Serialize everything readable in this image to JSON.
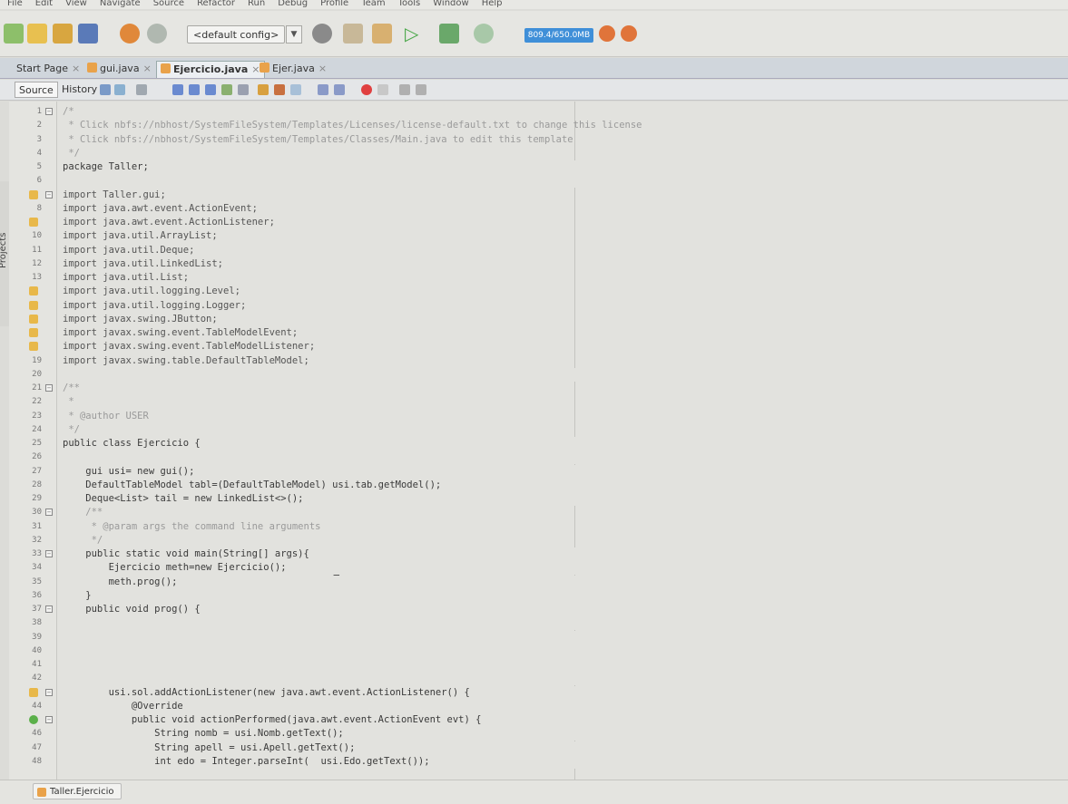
{
  "menu": [
    "File",
    "Edit",
    "View",
    "Navigate",
    "Source",
    "Refactor",
    "Run",
    "Debug",
    "Profile",
    "Team",
    "Tools",
    "Window",
    "Help"
  ],
  "toolbar": {
    "config_value": "<default config>",
    "memory": "809.4/650.0MB"
  },
  "tabs": [
    {
      "label": "Start Page",
      "active": false
    },
    {
      "label": "gui.java",
      "active": false
    },
    {
      "label": "Ejercicio.java",
      "active": true
    },
    {
      "label": "Ejer.java",
      "active": false
    }
  ],
  "editor_toolbar": {
    "source": "Source",
    "history": "History"
  },
  "side_panel": {
    "label": "Projects"
  },
  "code_lines": [
    {
      "n": "1",
      "text": "/*",
      "type": "comment",
      "fold": true
    },
    {
      "n": "2",
      "text": " * Click nbfs://nbhost/SystemFileSystem/Templates/Licenses/license-default.txt to change this license",
      "type": "comment"
    },
    {
      "n": "3",
      "text": " * Click nbfs://nbhost/SystemFileSystem/Templates/Classes/Main.java to edit this template",
      "type": "comment"
    },
    {
      "n": "4",
      "text": " */",
      "type": "comment"
    },
    {
      "n": "5",
      "text": "package Taller;",
      "type": "code"
    },
    {
      "n": "6",
      "text": "",
      "type": "code"
    },
    {
      "n": "",
      "text": "import Taller.gui;",
      "type": "import",
      "hint": "warn",
      "fold": true
    },
    {
      "n": "8",
      "text": "import java.awt.event.ActionEvent;",
      "type": "import"
    },
    {
      "n": "",
      "text": "import java.awt.event.ActionListener;",
      "type": "import",
      "hint": "warn"
    },
    {
      "n": "10",
      "text": "import java.util.ArrayList;",
      "type": "import"
    },
    {
      "n": "11",
      "text": "import java.util.Deque;",
      "type": "import"
    },
    {
      "n": "12",
      "text": "import java.util.LinkedList;",
      "type": "import"
    },
    {
      "n": "13",
      "text": "import java.util.List;",
      "type": "import"
    },
    {
      "n": "",
      "text": "import java.util.logging.Level;",
      "type": "import",
      "hint": "warn"
    },
    {
      "n": "",
      "text": "import java.util.logging.Logger;",
      "type": "import",
      "hint": "warn"
    },
    {
      "n": "",
      "text": "import javax.swing.JButton;",
      "type": "import",
      "hint": "warn"
    },
    {
      "n": "",
      "text": "import javax.swing.event.TableModelEvent;",
      "type": "import",
      "hint": "warn"
    },
    {
      "n": "",
      "text": "import javax.swing.event.TableModelListener;",
      "type": "import",
      "hint": "warn"
    },
    {
      "n": "19",
      "text": "import javax.swing.table.DefaultTableModel;",
      "type": "import"
    },
    {
      "n": "20",
      "text": "",
      "type": "code"
    },
    {
      "n": "21",
      "text": "/**",
      "type": "comment",
      "fold": true
    },
    {
      "n": "22",
      "text": " *",
      "type": "comment"
    },
    {
      "n": "23",
      "text": " * @author USER",
      "type": "comment"
    },
    {
      "n": "24",
      "text": " */",
      "type": "comment"
    },
    {
      "n": "25",
      "text": "public class Ejercicio {",
      "type": "code"
    },
    {
      "n": "26",
      "text": "",
      "type": "code"
    },
    {
      "n": "27",
      "text": "    gui usi= new gui();",
      "type": "code"
    },
    {
      "n": "28",
      "text": "    DefaultTableModel tabl=(DefaultTableModel) usi.tab.getModel();",
      "type": "code"
    },
    {
      "n": "29",
      "text": "    Deque<List> tail = new LinkedList<>();",
      "type": "code"
    },
    {
      "n": "30",
      "text": "    /**",
      "type": "comment",
      "fold": true
    },
    {
      "n": "31",
      "text": "     * @param args the command line arguments",
      "type": "comment"
    },
    {
      "n": "32",
      "text": "     */",
      "type": "comment"
    },
    {
      "n": "33",
      "text": "    public static void main(String[] args){",
      "type": "code",
      "fold": true
    },
    {
      "n": "34",
      "text": "        Ejercicio meth=new Ejercicio();",
      "type": "code"
    },
    {
      "n": "35",
      "text": "        meth.prog();",
      "type": "code"
    },
    {
      "n": "36",
      "text": "    }",
      "type": "code"
    },
    {
      "n": "37",
      "text": "    public void prog() {",
      "type": "code",
      "fold": true
    },
    {
      "n": "38",
      "text": "",
      "type": "code"
    },
    {
      "n": "39",
      "text": "",
      "type": "code"
    },
    {
      "n": "40",
      "text": "",
      "type": "code"
    },
    {
      "n": "41",
      "text": "",
      "type": "code"
    },
    {
      "n": "42",
      "text": "",
      "type": "code"
    },
    {
      "n": "",
      "text": "        usi.sol.addActionListener(new java.awt.event.ActionListener() {",
      "type": "code",
      "hint": "warn",
      "fold": true
    },
    {
      "n": "44",
      "text": "            @Override",
      "type": "code"
    },
    {
      "n": "",
      "text": "            public void actionPerformed(java.awt.event.ActionEvent evt) {",
      "type": "code",
      "hint": "ok",
      "fold": true
    },
    {
      "n": "46",
      "text": "                String nomb = usi.Nomb.getText();",
      "type": "code"
    },
    {
      "n": "47",
      "text": "                String apell = usi.Apell.getText();",
      "type": "code"
    },
    {
      "n": "48",
      "text": "                int edo = Integer.parseInt(  usi.Edo.getText());",
      "type": "code"
    }
  ],
  "breadcrumb": "Taller.Ejercicio"
}
